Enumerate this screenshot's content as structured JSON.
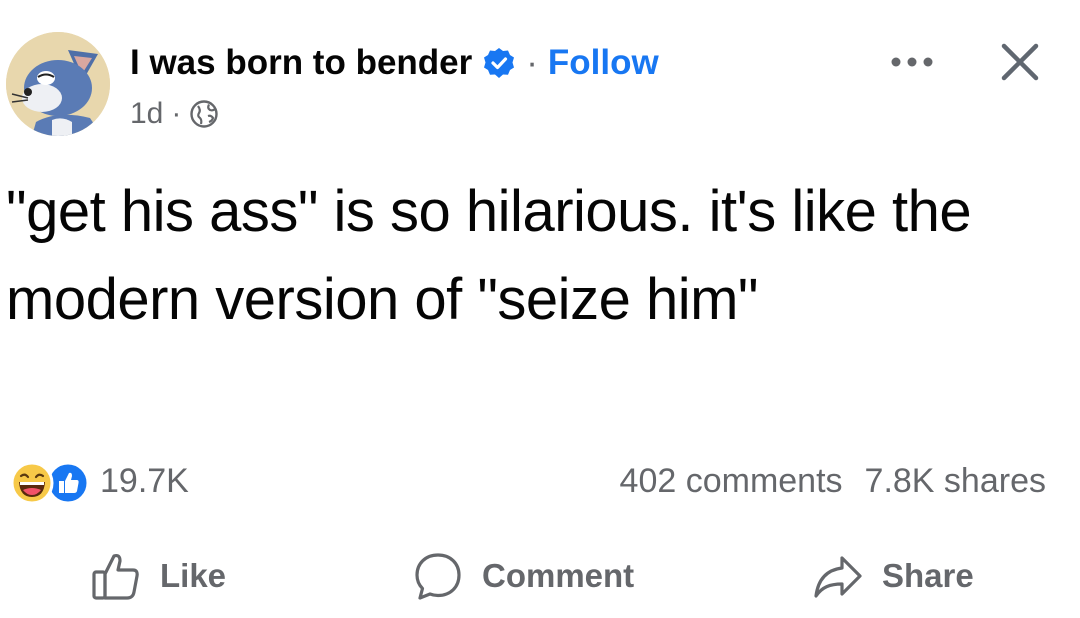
{
  "post": {
    "author": "I was born to bender",
    "separator": "·",
    "follow_label": "Follow",
    "time": "1d",
    "meta_separator": "·",
    "text": "\"get his ass\" is so hilarious. it's like the modern version of \"seize him\""
  },
  "icons": {
    "avatar": "tom-cat-avatar",
    "verified": "verified-badge-icon",
    "privacy": "globe-icon",
    "more": "more-options-icon",
    "close": "close-icon",
    "reaction_1": "haha-reaction-icon",
    "reaction_2": "like-reaction-icon"
  },
  "stats": {
    "reaction_count": "19.7K",
    "comments": "402 comments",
    "shares": "7.8K shares"
  },
  "actions": {
    "like_label": "Like",
    "comment_label": "Comment",
    "share_label": "Share"
  },
  "colors": {
    "brand_blue": "#1877f2",
    "text_primary": "#050505",
    "text_secondary": "#65676b",
    "haha_yellow": "#f7c948"
  }
}
